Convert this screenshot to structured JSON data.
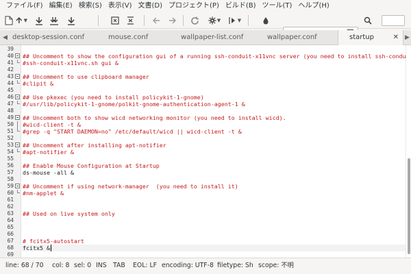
{
  "menu": [
    "ファイル(F)",
    "編集(E)",
    "検索(S)",
    "表示(V)",
    "文書(D)",
    "プロジェクト(P)",
    "ビルド(B)",
    "ツール(T)",
    "ヘルプ(H)"
  ],
  "toolbar": {
    "icons": [
      "new-file-icon",
      "open-file-icon",
      "save-icon",
      "save-all-icon",
      "revert-icon",
      "close-file-icon",
      "back-icon",
      "forward-icon",
      "compile-icon",
      "build-icon",
      "run-icon",
      "color-picker-icon",
      "search-icon"
    ],
    "search": {
      "value": "",
      "placeholder": ""
    }
  },
  "tabs": [
    {
      "label": "desktop-session.conf",
      "active": false
    },
    {
      "label": "mouse.conf",
      "active": false
    },
    {
      "label": "wallpaper-list.conf",
      "active": false
    },
    {
      "label": "wallpaper.conf",
      "active": false
    },
    {
      "label": "startup",
      "active": true
    }
  ],
  "editor": {
    "current_line": 68,
    "lines": [
      {
        "n": "39",
        "text": ""
      },
      {
        "n": "40",
        "text": "## Uncomment to show the configuration gui of a running ssh-conduit-x11vnc server (you need to install ssh-conduit)",
        "fold": "box"
      },
      {
        "n": "41",
        "text": "#ssh-conduit-x11vnc.sh gui &",
        "fold": "end"
      },
      {
        "n": "42",
        "text": ""
      },
      {
        "n": "43",
        "text": "## Uncomment to use clipboard manager",
        "fold": "box"
      },
      {
        "n": "44",
        "text": "#clipit &",
        "fold": "end"
      },
      {
        "n": "45",
        "text": ""
      },
      {
        "n": "46",
        "text": "## Use pkexec (you need to install policykit-1-gnome)",
        "fold": "box"
      },
      {
        "n": "47",
        "text": "#/usr/lib/policykit-1-gnome/polkit-gnome-authentication-agent-1 &",
        "fold": "end"
      },
      {
        "n": "48",
        "text": ""
      },
      {
        "n": "49",
        "text": "## Uncomment both to show wicd networking monitor (you need to install wicd).",
        "fold": "box"
      },
      {
        "n": "50",
        "text": "#wicd-client -t &",
        "fold": "cont"
      },
      {
        "n": "51",
        "text": "#grep -q \"START DAEMON=no\" /etc/default/wicd || wicd-client -t &",
        "fold": "end"
      },
      {
        "n": "52",
        "text": ""
      },
      {
        "n": "53",
        "text": "## Uncomment after installing apt-notifier",
        "fold": "box"
      },
      {
        "n": "54",
        "text": "#apt-notifier &",
        "fold": "end"
      },
      {
        "n": "55",
        "text": ""
      },
      {
        "n": "56",
        "text": "## Enable Mouse Configuration at Startup"
      },
      {
        "n": "57",
        "text": "ds-mouse -all &",
        "plain": true
      },
      {
        "n": "58",
        "text": ""
      },
      {
        "n": "59",
        "text": "## Uncomment if using network-manager  (you need to install it)",
        "fold": "box"
      },
      {
        "n": "60",
        "text": "#nm-applet &",
        "fold": "end"
      },
      {
        "n": "61",
        "text": ""
      },
      {
        "n": "62",
        "text": ""
      },
      {
        "n": "63",
        "text": "## Used on live system only"
      },
      {
        "n": "64",
        "text": ""
      },
      {
        "n": "65",
        "text": ""
      },
      {
        "n": "66",
        "text": ""
      },
      {
        "n": "67",
        "text": "# fcitx5-autostart"
      },
      {
        "n": "68",
        "text": "fcitx5 &",
        "plain": true,
        "current": true
      },
      {
        "n": "69",
        "text": ""
      }
    ]
  },
  "status": {
    "line": "line: 68 / 70",
    "col": "col: 8",
    "sel": "sel: 0",
    "ins": "INS",
    "tab": "TAB",
    "eol": "EOL: LF",
    "encoding": "encoding: UTF-8",
    "filetype": "filetype: Sh",
    "scope": "scope: 不明"
  },
  "colors": {
    "comment": "#c4191a",
    "text": "#1a1a1a",
    "gutter": "#f1f1f1",
    "chrome": "#f6f5f4"
  }
}
